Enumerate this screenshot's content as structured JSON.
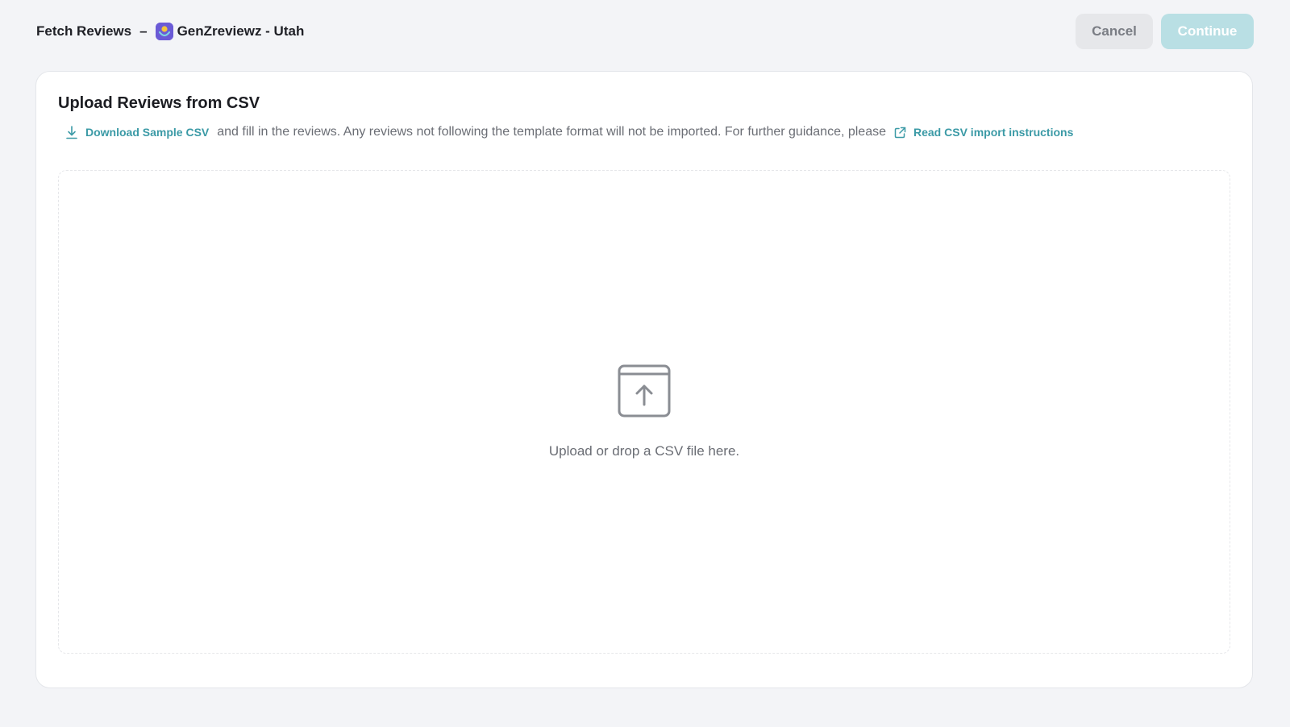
{
  "header": {
    "title": "Fetch Reviews",
    "separator": "–",
    "app_icon": "genzreviewz-app-icon",
    "location_name": "GenZreviewz - Utah",
    "cancel_label": "Cancel",
    "continue_label": "Continue"
  },
  "card": {
    "title": "Upload Reviews from CSV",
    "download_link": "Download Sample CSV",
    "download_icon": "download-icon",
    "guidance_text": "and fill in the reviews. Any reviews not following the template format will not be imported. For further guidance, please",
    "instructions_link": "Read CSV import instructions",
    "instructions_icon": "external-link-icon"
  },
  "dropzone": {
    "icon": "upload-box-icon",
    "text": "Upload or drop a CSV file here."
  },
  "colors": {
    "accent": "#3b9aa6",
    "continue_disabled": "#b9dfe4",
    "page_background": "#f3f4f7"
  }
}
